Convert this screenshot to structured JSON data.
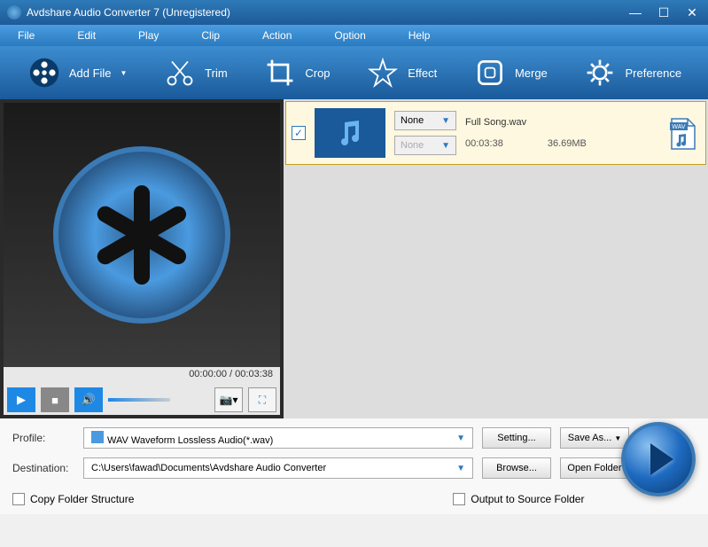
{
  "titlebar": {
    "title": "Avdshare Audio Converter 7 (Unregistered)"
  },
  "menubar": [
    "File",
    "Edit",
    "Play",
    "Clip",
    "Action",
    "Option",
    "Help"
  ],
  "toolbar": [
    {
      "label": "Add File",
      "icon": "film-reel",
      "caret": true
    },
    {
      "label": "Trim",
      "icon": "scissors",
      "caret": false
    },
    {
      "label": "Crop",
      "icon": "crop",
      "caret": false
    },
    {
      "label": "Effect",
      "icon": "star",
      "caret": false
    },
    {
      "label": "Merge",
      "icon": "merge-square",
      "caret": false
    },
    {
      "label": "Preference",
      "icon": "gear",
      "caret": false
    }
  ],
  "preview": {
    "time_display": "00:00:00 / 00:03:38"
  },
  "file_list": {
    "items": [
      {
        "checked": true,
        "dropdown1": "None",
        "dropdown2": "None",
        "filename": "Full Song.wav",
        "duration": "00:03:38",
        "size": "36.69MB",
        "format_badge": "WAV"
      }
    ]
  },
  "bottom": {
    "profile_label": "Profile:",
    "profile_value": "WAV Waveform Lossless Audio(*.wav)",
    "setting_btn": "Setting...",
    "saveas_btn": "Save As...",
    "destination_label": "Destination:",
    "destination_value": "C:\\Users\\fawad\\Documents\\Avdshare Audio Converter",
    "browse_btn": "Browse...",
    "openfolder_btn": "Open Folder",
    "copy_folder_label": "Copy Folder Structure",
    "output_source_label": "Output to Source Folder"
  }
}
